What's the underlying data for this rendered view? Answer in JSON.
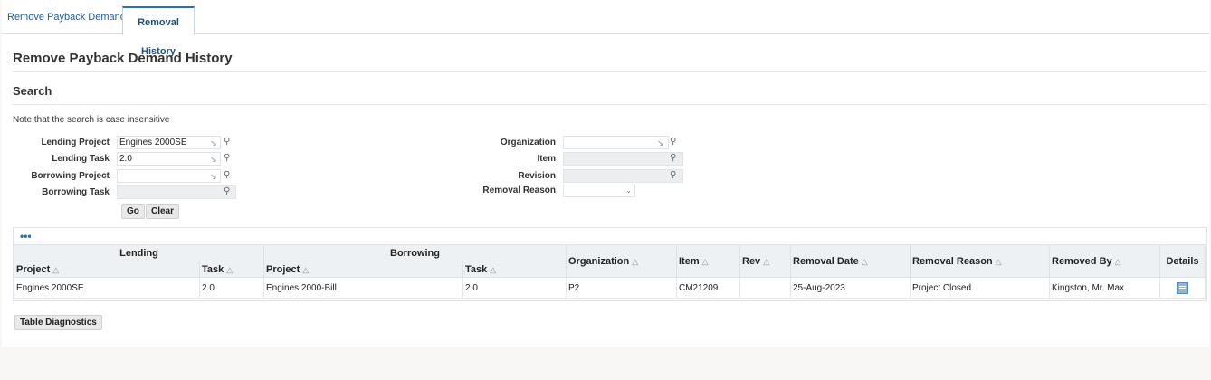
{
  "tabs": [
    {
      "label": "Remove Payback Demands"
    },
    {
      "label": "Removal History"
    }
  ],
  "page_title": "Remove Payback Demand History",
  "search": {
    "title": "Search",
    "note": "Note that the search is case insensitive",
    "fields": {
      "lending_project": {
        "label": "Lending Project",
        "value": "Engines 2000SE"
      },
      "lending_task": {
        "label": "Lending Task",
        "value": "2.0"
      },
      "borrowing_project": {
        "label": "Borrowing Project",
        "value": ""
      },
      "borrowing_task": {
        "label": "Borrowing Task",
        "value": ""
      },
      "organization": {
        "label": "Organization",
        "value": ""
      },
      "item": {
        "label": "Item",
        "value": ""
      },
      "revision": {
        "label": "Revision",
        "value": ""
      },
      "removal_reason": {
        "label": "Removal Reason",
        "value": ""
      }
    },
    "go_label": "Go",
    "clear_label": "Clear"
  },
  "table": {
    "more_label": "•••",
    "groups": {
      "lending": "Lending",
      "borrowing": "Borrowing"
    },
    "columns": {
      "project": "Project",
      "task": "Task",
      "organization": "Organization",
      "item": "Item",
      "rev": "Rev",
      "removal_date": "Removal Date",
      "removal_reason": "Removal Reason",
      "removed_by": "Removed By",
      "details": "Details"
    },
    "rows": [
      {
        "lending_project": "Engines 2000SE",
        "lending_task": "2.0",
        "borrowing_project": "Engines 2000-Bill",
        "borrowing_task": "2.0",
        "organization": "P2",
        "item": "CM21209",
        "rev": "",
        "removal_date": "25-Aug-2023",
        "removal_reason": "Project Closed",
        "removed_by": "Kingston, Mr. Max"
      }
    ]
  },
  "diagnostics_label": "Table Diagnostics",
  "icons": {
    "sort": "△",
    "lov": "↘",
    "search": "🔍",
    "select": "⌄",
    "details": "details-icon"
  },
  "colors": {
    "accent": "#2a6fb2",
    "link": "#1f5c99"
  }
}
